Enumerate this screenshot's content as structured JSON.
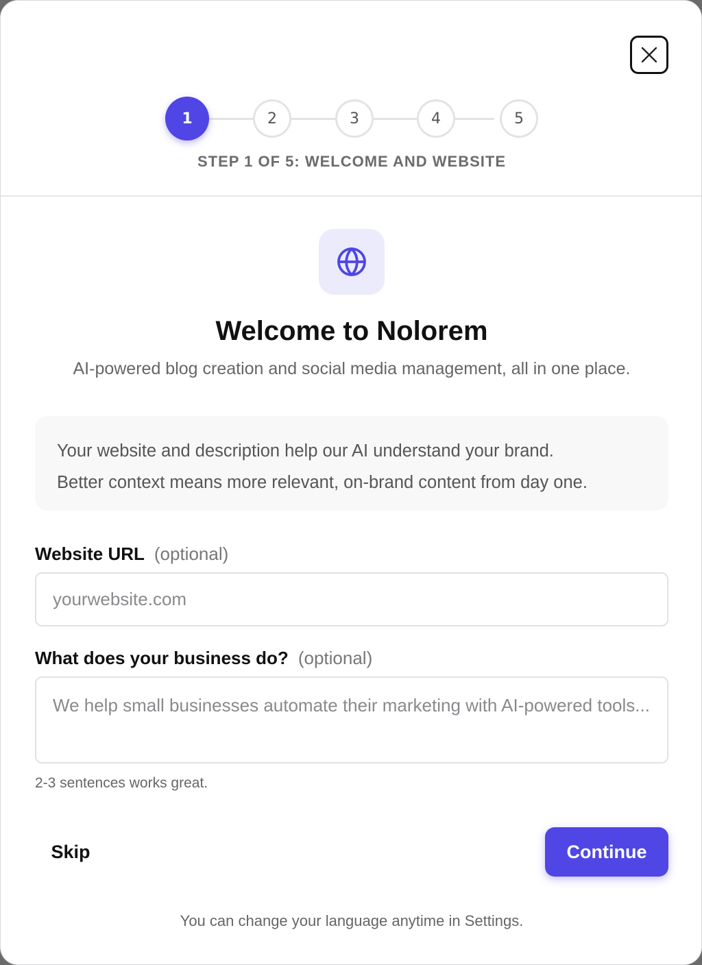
{
  "dialog": {
    "close_icon": "close-icon"
  },
  "stepper": {
    "steps": [
      "1",
      "2",
      "3",
      "4",
      "5"
    ],
    "current_step": 1,
    "caption": "STEP 1 OF 5: WELCOME AND WEBSITE",
    "accent_color": "#4f46e5"
  },
  "hero": {
    "icon": "globe-icon",
    "title": "Welcome to Nolorem",
    "subtitle": "AI-powered blog creation and social media management, all in one place."
  },
  "info": {
    "line1": "Your website and description help our AI understand your brand.",
    "line2": "Better context means more relevant, on-brand content from day one."
  },
  "form": {
    "website": {
      "label": "Website URL",
      "optional": "(optional)",
      "placeholder": "yourwebsite.com",
      "value": ""
    },
    "business": {
      "label": "What does your business do?",
      "optional": "(optional)",
      "placeholder": "We help small businesses automate their marketing with AI-powered tools...",
      "value": "",
      "hint": "2-3 sentences works great."
    }
  },
  "actions": {
    "skip_label": "Skip",
    "continue_label": "Continue"
  },
  "footer": {
    "note": "You can change your language anytime in Settings."
  }
}
